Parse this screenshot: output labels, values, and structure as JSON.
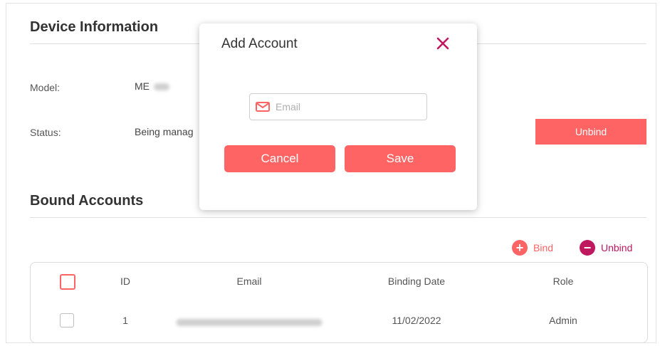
{
  "device_info": {
    "title": "Device Information",
    "model_label": "Model:",
    "model_value": "ME",
    "status_label": "Status:",
    "status_value": "Being manag",
    "unbind_button": "Unbind"
  },
  "bound_accounts": {
    "title": "Bound Accounts",
    "bind_label": "Bind",
    "unbind_label": "Unbind",
    "columns": [
      "ID",
      "Email",
      "Binding Date",
      "Role"
    ],
    "rows": [
      {
        "id": "1",
        "binding_date": "11/02/2022",
        "role": "Admin"
      }
    ]
  },
  "modal": {
    "title": "Add Account",
    "email_placeholder": "Email",
    "email_value": "",
    "cancel_label": "Cancel",
    "save_label": "Save"
  },
  "colors": {
    "accent": "#ff6464",
    "unbind_icon": "#c0185f",
    "close_icon": "#c0185f",
    "checkbox_header_border": "#ff6464",
    "checkbox_row_border": "#bdbdbd"
  },
  "icons": {
    "bind": "plus-circle-icon",
    "unbind": "minus-circle-icon",
    "email": "envelope-icon",
    "close": "close-icon"
  }
}
